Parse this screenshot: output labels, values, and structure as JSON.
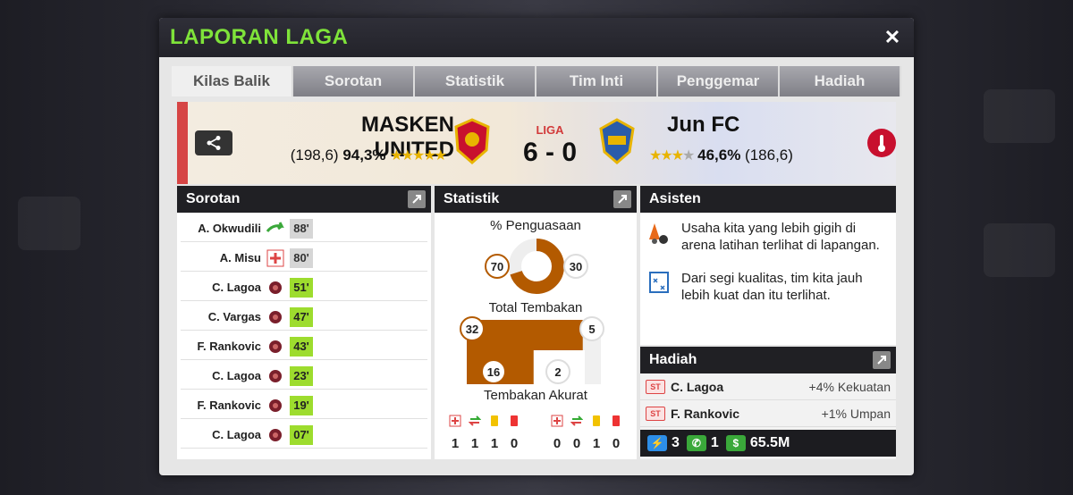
{
  "modal": {
    "title": "LAPORAN LAGA"
  },
  "tabs": [
    {
      "label": "Kilas Balik",
      "active": true
    },
    {
      "label": "Sorotan"
    },
    {
      "label": "Statistik"
    },
    {
      "label": "Tim Inti"
    },
    {
      "label": "Penggemar"
    },
    {
      "label": "Hadiah"
    }
  ],
  "match": {
    "home_name": "MASKEN UNITED",
    "home_rating": "(198,6)",
    "home_pct": "94,3%",
    "home_stars": 4.5,
    "league_label": "LIGA",
    "score": "6 - 0",
    "away_name": "Jun FC",
    "away_rating": "(186,6)",
    "away_pct": "46,6%",
    "away_stars": 2.5
  },
  "highlights": {
    "title": "Sorotan",
    "events": [
      {
        "player": "A. Okwudili",
        "icon": "substitution-arrow-icon",
        "minute": "88'",
        "kind": "grey"
      },
      {
        "player": "A. Misu",
        "icon": "injury-cross-icon",
        "minute": "80'",
        "kind": "grey"
      },
      {
        "player": "C. Lagoa",
        "icon": "ball-icon",
        "minute": "51'",
        "kind": "green"
      },
      {
        "player": "C. Vargas",
        "icon": "ball-icon",
        "minute": "47'",
        "kind": "green"
      },
      {
        "player": "F. Rankovic",
        "icon": "ball-icon",
        "minute": "43'",
        "kind": "green"
      },
      {
        "player": "C. Lagoa",
        "icon": "ball-icon",
        "minute": "23'",
        "kind": "green"
      },
      {
        "player": "F. Rankovic",
        "icon": "ball-icon",
        "minute": "19'",
        "kind": "green"
      },
      {
        "player": "C. Lagoa",
        "icon": "ball-icon",
        "minute": "07'",
        "kind": "green"
      }
    ]
  },
  "stats": {
    "title": "Statistik",
    "possession_label": "% Penguasaan",
    "possession_home": "70",
    "possession_away": "30",
    "shots_label": "Total Tembakan",
    "shots_home": "32",
    "shots_away": "5",
    "on_target_home": "16",
    "on_target_away": "2",
    "on_target_label": "Tembakan Akurat",
    "home_counts": [
      "1",
      "1",
      "1",
      "0"
    ],
    "away_counts": [
      "0",
      "0",
      "1",
      "0"
    ],
    "count_icons": [
      "injury-icon",
      "substitution-icon",
      "yellow-card-icon",
      "red-card-icon"
    ]
  },
  "assistant": {
    "title": "Asisten",
    "tips": [
      {
        "icon": "training-cones-icon",
        "text": "Usaha kita yang lebih gigih di arena latihan terlihat di lapangan."
      },
      {
        "icon": "tactics-board-icon",
        "text": "Dari segi kualitas, tim kita jauh lebih kuat dan itu terlihat."
      }
    ]
  },
  "rewards": {
    "title": "Hadiah",
    "items": [
      {
        "pos": "ST",
        "player": "C. Lagoa",
        "value": "+4% Kekuatan"
      },
      {
        "pos": "ST",
        "player": "F. Rankovic",
        "value": "+1% Umpan"
      }
    ],
    "energy": "3",
    "boost": "1",
    "money": "65.5M"
  },
  "colors": {
    "title_green": "#7fe33a",
    "home_brown": "#b35a00",
    "minute_green": "#9ddc2e",
    "home_accent": "#d64545"
  }
}
